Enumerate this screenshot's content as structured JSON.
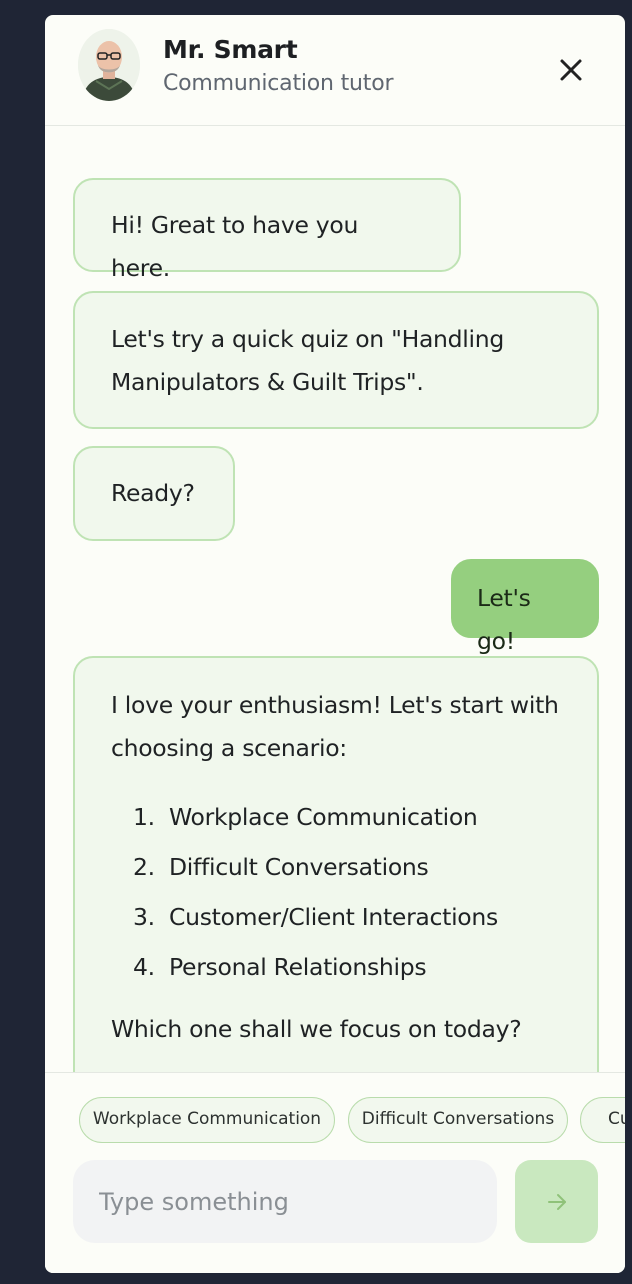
{
  "header": {
    "name": "Mr. Smart",
    "role": "Communication tutor"
  },
  "messages": [
    {
      "from": "tutor",
      "text": "Hi! Great to have you here."
    },
    {
      "from": "tutor",
      "lines": [
        "Let's try a quick quiz on \"Handling",
        "Manipulators & Guilt Trips\"."
      ]
    },
    {
      "from": "tutor",
      "text": "Ready?"
    },
    {
      "from": "user",
      "text": "Let's go!"
    },
    {
      "from": "tutor",
      "intro_lines": [
        "I love your enthusiasm! Let's start with",
        "choosing a scenario:"
      ],
      "options": [
        {
          "num": "1.",
          "label": "Workplace Communication"
        },
        {
          "num": "2.",
          "label": "Difficult Conversations"
        },
        {
          "num": "3.",
          "label": "Customer/Client Interactions"
        },
        {
          "num": "4.",
          "label": "Personal Relationships"
        }
      ],
      "outro": "Which one shall we focus on today?"
    }
  ],
  "quick_replies": [
    "Workplace Communication",
    "Difficult Conversations",
    "Customer/Client Interactions"
  ],
  "composer": {
    "placeholder": "Type something"
  },
  "icons": {
    "close": "close-icon",
    "send": "arrow-right-icon",
    "avatar": "tutor-avatar"
  },
  "colors": {
    "backdrop": "#1f2535",
    "tutor_bubble": "#f1f8ed",
    "tutor_border": "#bfe3b4",
    "user_bubble": "#95cf7f",
    "send_button": "#c9e8bf"
  }
}
